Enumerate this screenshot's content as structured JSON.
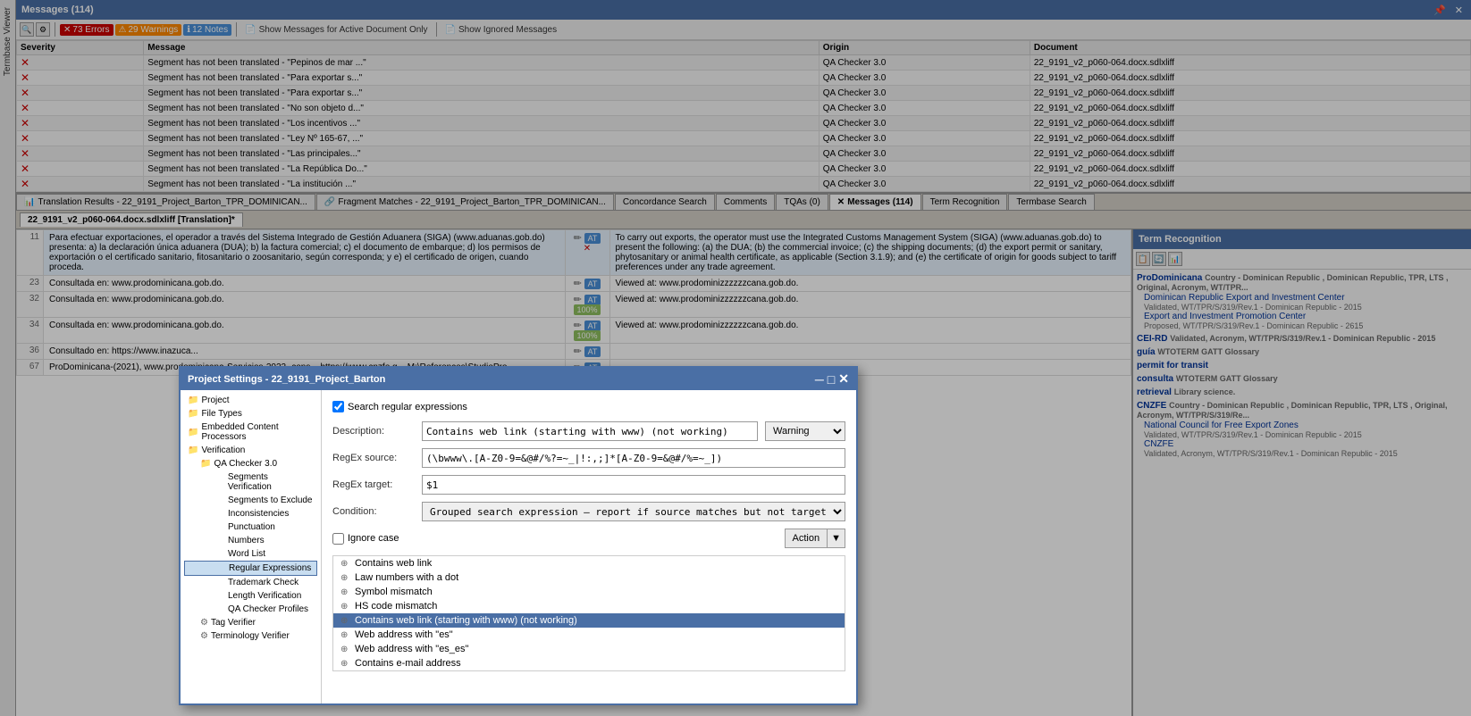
{
  "messages_panel": {
    "title": "Messages (114)",
    "toolbar": {
      "errors_label": "73 Errors",
      "warnings_label": "29 Warnings",
      "notes_label": "12 Notes",
      "show_active_label": "Show Messages for Active Document Only",
      "show_ignored_label": "Show Ignored Messages"
    },
    "columns": [
      "Severity",
      "Message",
      "Origin",
      "Document"
    ],
    "rows": [
      {
        "severity": "error",
        "message": "Segment has not been translated - \"Pepinos de mar ...\"",
        "origin": "QA Checker 3.0",
        "document": "22_9191_v2_p060-064.docx.sdlxliff"
      },
      {
        "severity": "error",
        "message": "Segment has not been translated - \"Para exportar s...\"",
        "origin": "QA Checker 3.0",
        "document": "22_9191_v2_p060-064.docx.sdlxliff"
      },
      {
        "severity": "error",
        "message": "Segment has not been translated - \"Para exportar s...\"",
        "origin": "QA Checker 3.0",
        "document": "22_9191_v2_p060-064.docx.sdlxliff"
      },
      {
        "severity": "error",
        "message": "Segment has not been translated - \"No son objeto d...\"",
        "origin": "QA Checker 3.0",
        "document": "22_9191_v2_p060-064.docx.sdlxliff"
      },
      {
        "severity": "error",
        "message": "Segment has not been translated - \"Los incentivos ...\"",
        "origin": "QA Checker 3.0",
        "document": "22_9191_v2_p060-064.docx.sdlxliff"
      },
      {
        "severity": "error",
        "message": "Segment has not been translated - \"Ley Nº 165-67, ...\"",
        "origin": "QA Checker 3.0",
        "document": "22_9191_v2_p060-064.docx.sdlxliff"
      },
      {
        "severity": "error",
        "message": "Segment has not been translated - \"Las principales...\"",
        "origin": "QA Checker 3.0",
        "document": "22_9191_v2_p060-064.docx.sdlxliff"
      },
      {
        "severity": "error",
        "message": "Segment has not been translated - \"La República Do...\"",
        "origin": "QA Checker 3.0",
        "document": "22_9191_v2_p060-064.docx.sdlxliff"
      },
      {
        "severity": "error",
        "message": "Segment has not been translated - \"La institución ...\"",
        "origin": "QA Checker 3.0",
        "document": "22_9191_v2_p060-064.docx.sdlxliff"
      }
    ]
  },
  "tabs": [
    {
      "label": "Translation Results - 22_9191_Project_Barton_TPR_DOMINICAN...",
      "active": false
    },
    {
      "label": "Fragment Matches - 22_9191_Project_Barton_TPR_DOMINICAN...",
      "active": false
    },
    {
      "label": "Concordance Search",
      "active": false
    },
    {
      "label": "Comments",
      "active": false
    },
    {
      "label": "TQAs (0)",
      "active": false
    },
    {
      "label": "Messages (114)",
      "active": true
    },
    {
      "label": "Term Recognition",
      "active": false
    },
    {
      "label": "Termbase Search",
      "active": false
    }
  ],
  "file_tab": "22_9191_v2_p060-064.docx.sdlxliff [Translation]*",
  "segments": [
    {
      "num": "11",
      "source": "Para efectuar exportaciones, el operador a través del Sistema Integrado de Gestión Aduanera (SIGA) (www.aduanas.gob.do) presenta: a) la declaración única aduanera (DUA); b) la factura comercial; c) el documento de embarque; d) los permisos de exportación o el certificado sanitario, fitosanitario o zoosanitario, según corresponda; y e) el certificado de origen, cuando proceda.",
      "target": "To carry out exports, the operator must use the Integrated Customs Management System (SIGA) (www.aduanas.gob.do) to present the following: (a) the DUA; (b) the commercial invoice; (c) the shipping documents; (d) the export permit or sanitary, phytosanitary or animal health certificate, as applicable (Section 3.1.9); and (e) the certificate of origin for goods subject to tariff preferences under any trade agreement.",
      "match": "",
      "active": true
    },
    {
      "num": "23",
      "source": "Consultada en: www.prodominicana.gob.do.",
      "target": "Viewed at: www.prodominizzzzzzcana.gob.do.",
      "match": "",
      "active": false
    },
    {
      "num": "32",
      "source": "Consultada en: www.prodominicana.gob.do.",
      "target": "Viewed at: www.prodominizzzzzzcana.gob.do.",
      "match": "100%",
      "active": false
    },
    {
      "num": "34",
      "source": "Consultada en: www.prodominicana.gob.do.",
      "target": "Viewed at: www.prodominizzzzzzcana.gob.do.",
      "match": "100%",
      "active": false
    },
    {
      "num": "36",
      "source": "Consultado en: https://www.inazuca...",
      "target": "",
      "match": "",
      "active": false
    },
    {
      "num": "67",
      "source": "ProDominicana-(2021), www.prodominicana-Servicios-2022,-cons... https://www.cnzfe.g... M:\\References\\StudioPro...",
      "target": "",
      "match": "",
      "active": false
    }
  ],
  "term_recognition": {
    "title": "Term Recognition",
    "terms": [
      {
        "name": "ProDominicana",
        "detail": "Country - Dominican Republic , Dominican Republic, TPR, LTS , Original, Acronym, WT/TPR...",
        "entries": [
          {
            "text": "Dominican Republic Export and Investment Center",
            "status": "Validated, WT/TPR/S/319/Rev.1 - Dominican Republic - 2015"
          },
          {
            "text": "Export and Investment Promotion Center",
            "status": "Proposed, WT/TPR/S/319/Rev.1 - Dominican Republic - 2615"
          }
        ]
      },
      {
        "name": "CEI-RD",
        "detail": "Validated, Acronym, WT/TPR/S/319/Rev.1 - Dominican Republic - 2015",
        "entries": []
      },
      {
        "name": "guía",
        "detail": "WTOTERM  GATT Glossary",
        "entries": []
      },
      {
        "name": "permit for transit",
        "detail": "",
        "entries": []
      },
      {
        "name": "consulta",
        "detail": "WTOTERM  GATT Glossary",
        "entries": []
      },
      {
        "name": "retrieval",
        "detail": "Library science.",
        "entries": []
      },
      {
        "name": "CNZFE",
        "detail": "Country - Dominican Republic , Dominican Republic, TPR, LTS , Original, Acronym, WT/TPR/S/319/Re...",
        "entries": [
          {
            "text": "National Council for Free Export Zones",
            "status": "Validated, WT/TPR/S/319/Rev.1 - Dominican Republic - 2015"
          },
          {
            "text": "CNZFE",
            "status": "Validated, Acronym, WT/TPR/S/319/Rev.1 - Dominican Republic - 2015"
          }
        ]
      }
    ]
  },
  "modal": {
    "title": "Project Settings - 22_9191_Project_Barton",
    "section_title": "Regular Expressions",
    "checkbox_label": "Search regular expressions",
    "fields": {
      "description_label": "Description:",
      "description_value": "Contains web link (starting with www) (not working)",
      "regex_source_label": "RegEx source:",
      "regex_source_value": "(\\bwww\\.[A-Z0-9=&@#/%?=~_|!:,;]*[A-Z0-9=&@#/%=~_])",
      "regex_target_label": "RegEx target:",
      "regex_target_value": "$1",
      "condition_label": "Condition:",
      "condition_value": "Grouped search expression – report if source matches but not target",
      "ignore_case_label": "Ignore case"
    },
    "warning_label": "Warning",
    "action_label": "Action",
    "tree_items": [
      {
        "label": "Contains web link",
        "expanded": false,
        "indent": 0
      },
      {
        "label": "Law numbers with a dot",
        "expanded": false,
        "indent": 0
      },
      {
        "label": "Symbol mismatch",
        "expanded": false,
        "indent": 0
      },
      {
        "label": "HS code mismatch",
        "expanded": false,
        "indent": 0
      },
      {
        "label": "Contains web link (starting with www) (not working)",
        "expanded": false,
        "indent": 0,
        "selected": true
      },
      {
        "label": "Web address with \"es\"",
        "expanded": false,
        "indent": 0
      },
      {
        "label": "Web address with \"es_es\"",
        "expanded": false,
        "indent": 0
      },
      {
        "label": "Contains e-mail address",
        "expanded": false,
        "indent": 0
      }
    ],
    "nav": [
      {
        "label": "Project",
        "indent": 0,
        "icon": "folder"
      },
      {
        "label": "File Types",
        "indent": 0,
        "icon": "folder"
      },
      {
        "label": "Embedded Content Processors",
        "indent": 0,
        "icon": "folder"
      },
      {
        "label": "Verification",
        "indent": 0,
        "icon": "folder",
        "expanded": true
      },
      {
        "label": "QA Checker 3.0",
        "indent": 1,
        "icon": "folder",
        "expanded": true
      },
      {
        "label": "Segments Verification",
        "indent": 2
      },
      {
        "label": "Segments to Exclude",
        "indent": 2
      },
      {
        "label": "Inconsistencies",
        "indent": 2
      },
      {
        "label": "Punctuation",
        "indent": 2
      },
      {
        "label": "Numbers",
        "indent": 2
      },
      {
        "label": "Word List",
        "indent": 2
      },
      {
        "label": "Regular Expressions",
        "indent": 2,
        "active": true
      },
      {
        "label": "Trademark Check",
        "indent": 2
      },
      {
        "label": "Length Verification",
        "indent": 2
      },
      {
        "label": "QA Checker Profiles",
        "indent": 2
      },
      {
        "label": "Tag Verifier",
        "indent": 1,
        "icon": "gear"
      },
      {
        "label": "Terminology Verifier",
        "indent": 1,
        "icon": "gear"
      }
    ]
  }
}
